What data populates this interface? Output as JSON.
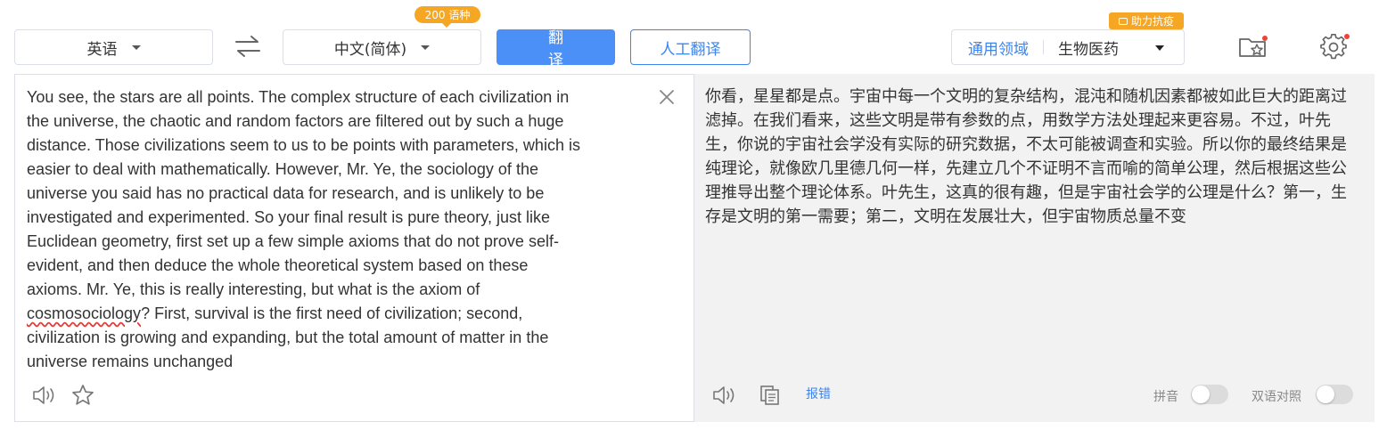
{
  "toolbar": {
    "source_language": "英语",
    "target_language": "中文(简体)",
    "languages_badge": "200 语种",
    "translate_button": "翻 译",
    "human_translate_button": "人工翻译",
    "domain_label": "通用领域",
    "domain_value": "生物医药",
    "help_badge": "助力抗疫"
  },
  "source": {
    "text_before": "You see, the stars are all points. The complex structure of each civilization in\nthe universe, the chaotic and random factors are filtered out by such a huge\ndistance. Those civilizations seem to us to be points with parameters, which is\neasier to deal with mathematically. However, Mr. Ye, the sociology of the\nuniverse you said has no practical data for research, and is unlikely to be\ninvestigated and experimented. So your final result is pure theory, just like\nEuclidean geometry, first set up a few simple axioms that do not prove self-\nevident, and then deduce the whole theoretical system based on these\naxioms. Mr. Ye, this is really interesting, but what is the axiom of\n",
    "misspelled_word": "cosmosociology",
    "text_after": "? First, survival is the first need of civilization; second,\ncivilization is growing and expanding, but the total amount of matter in the\nuniverse remains unchanged"
  },
  "target": {
    "text": "你看，星星都是点。宇宙中每一个文明的复杂结构，混沌和随机因素都被如此巨大的距离过滤掉。在我们看来，这些文明是带有参数的点，用数学方法处理起来更容易。不过，叶先生，你说的宇宙社会学没有实际的研究数据，不太可能被调查和实验。所以你的最终结果是纯理论，就像欧几里德几何一样，先建立几个不证明不言而喻的简单公理，然后根据这些公理推导出整个理论体系。叶先生，这真的很有趣，但是宇宙社会学的公理是什么？第一，生存是文明的第一需要；第二，文明在发展壮大，但宇宙物质总量不变",
    "report_error": "报错",
    "pinyin_label": "拼音",
    "pinyin_on": false,
    "bilingual_label": "双语对照",
    "bilingual_on": false
  },
  "icons": [
    "swap-icon",
    "favorites-folder-icon",
    "settings-gear-icon",
    "clear-icon",
    "speaker-icon",
    "star-icon",
    "copy-icon"
  ],
  "colors": {
    "accent": "#4a90f7",
    "badge": "#f5a623",
    "notification": "#f0413b"
  }
}
